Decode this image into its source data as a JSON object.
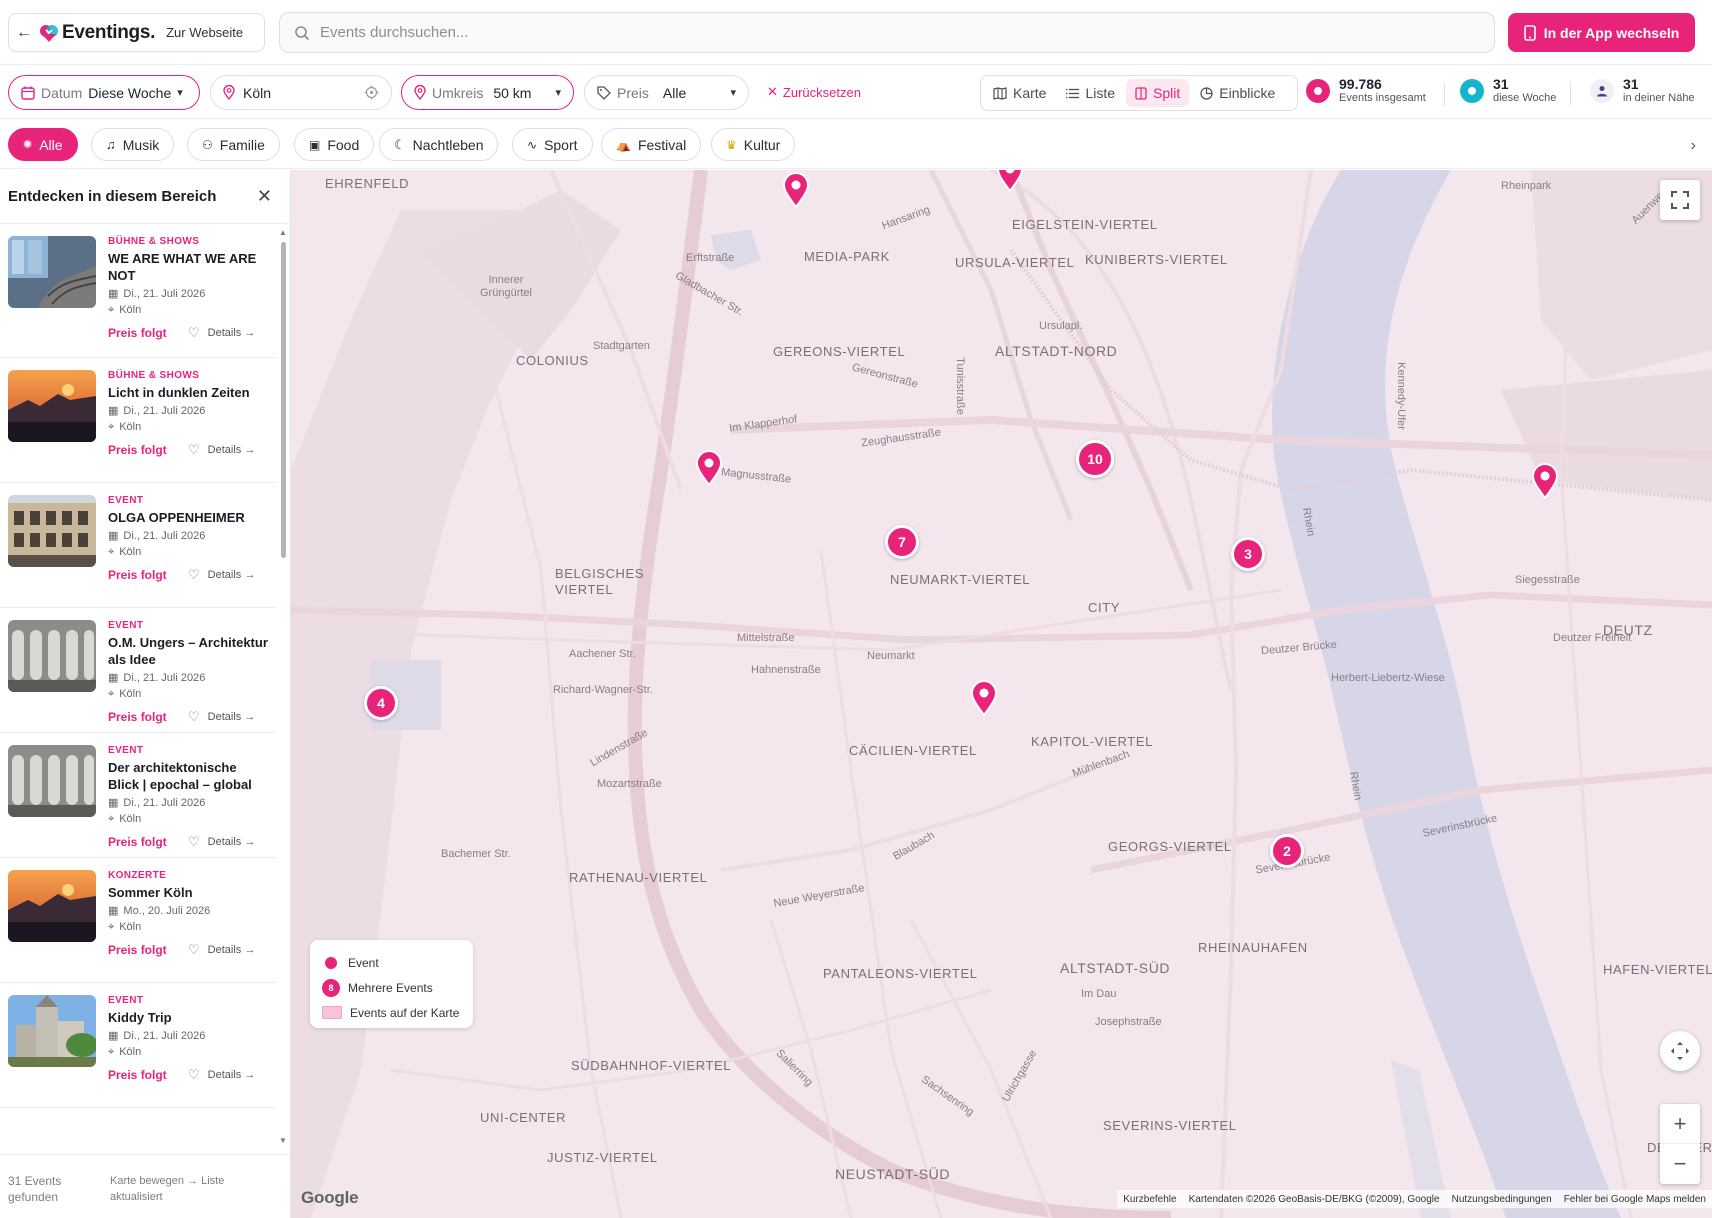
{
  "header": {
    "back_label": "←",
    "logo_text": "Eventings.",
    "website_link": "Zur Webseite",
    "search_placeholder": "Events durchsuchen...",
    "app_button": "In der App wechseln"
  },
  "filters": {
    "date_label": "Datum",
    "date_value": "Diese Woche",
    "location_value": "Köln",
    "radius_label": "Umkreis",
    "radius_value": "50 km",
    "price_label": "Preis",
    "price_value": "Alle",
    "reset_label": "Zurücksetzen"
  },
  "views": [
    {
      "label": "Karte",
      "icon": "map-icon",
      "active": false
    },
    {
      "label": "Liste",
      "icon": "list-icon",
      "active": false
    },
    {
      "label": "Split",
      "icon": "split-icon",
      "active": true
    },
    {
      "label": "Einblicke",
      "icon": "chart-pie-icon",
      "active": false
    }
  ],
  "stats": [
    {
      "value": "99.786",
      "label": "Events insgesamt",
      "color": "#e8247a"
    },
    {
      "value": "31",
      "label": "diese Woche",
      "color": "#12b5cb"
    },
    {
      "value": "31",
      "label": "in deiner Nähe",
      "color": "#4a3f8a"
    }
  ],
  "categories": [
    "Alle",
    "Musik",
    "Familie",
    "Food",
    "Nachtleben",
    "Sport",
    "Festival",
    "Kultur"
  ],
  "sidebar": {
    "title": "Entdecken in diesem Bereich",
    "events": [
      {
        "category": "BÜHNE & SHOWS",
        "title": "WE ARE WHAT WE ARE NOT",
        "date": "Di., 21. Juli 2026",
        "city": "Köln",
        "price": "Preis folgt",
        "details": "Details →",
        "thumb": "glass"
      },
      {
        "category": "BÜHNE & SHOWS",
        "title": "Licht in dunklen Zeiten",
        "date": "Di., 21. Juli 2026",
        "city": "Köln",
        "price": "Preis folgt",
        "details": "Details →",
        "thumb": "sunset"
      },
      {
        "category": "EVENT",
        "title": "OLGA OPPENHEIMER",
        "date": "Di., 21. Juli 2026",
        "city": "Köln",
        "price": "Preis folgt",
        "details": "Details →",
        "thumb": "building"
      },
      {
        "category": "EVENT",
        "title": "O.M. Ungers – Architektur als Idee",
        "date": "Di., 21. Juli 2026",
        "city": "Köln",
        "price": "Preis folgt",
        "details": "Details →",
        "thumb": "arcade"
      },
      {
        "category": "EVENT",
        "title": "Der architektonische Blick | epochal – global",
        "date": "Di., 21. Juli 2026",
        "city": "Köln",
        "price": "Preis folgt",
        "details": "Details →",
        "thumb": "arcade"
      },
      {
        "category": "KONZERTE",
        "title": "Sommer Köln",
        "date": "Mo., 20. Juli 2026",
        "city": "Köln",
        "price": "Preis folgt",
        "details": "Details →",
        "thumb": "sunset"
      },
      {
        "category": "EVENT",
        "title": "Kiddy Trip",
        "date": "Di., 21. Juli 2026",
        "city": "Köln",
        "price": "Preis folgt",
        "details": "Details →",
        "thumb": "church"
      }
    ],
    "footer_count": "31 Events gefunden",
    "footer_hint": "Karte bewegen → Liste aktualisiert"
  },
  "map": {
    "district_labels": [
      "EHRENFELD",
      "MEDIA-PARK",
      "EIGELSTEIN-VIERTEL",
      "URSULA-VIERTEL",
      "KUNIBERTS-VIERTEL",
      "GEREONS-VIERTEL",
      "ALTSTADT-NORD",
      "COLONIUS",
      "BELGISCHES VIERTEL",
      "NEUMARKT-VIERTEL",
      "CITY",
      "DEUTZ",
      "CÄCILIEN-VIERTEL",
      "KAPITOL-VIERTEL",
      "GEORGS-VIERTEL",
      "RATHENAU-VIERTEL",
      "RHEINAUHAFEN",
      "PANTALEONS-VIERTEL",
      "ALTSTADT-SÜD",
      "HAFEN-VIERTEL",
      "SÜDBAHNHOF-VIERTEL",
      "UNI-CENTER",
      "SEVERINS-VIERTEL",
      "JUSTIZ-VIERTEL",
      "NEUSTADT-SÜD",
      "DEUTZER H"
    ],
    "street_labels": [
      "Hansaring",
      "Erftstraße",
      "Gladbacher Str.",
      "Innerer Grüngürtel",
      "Stadtgarten",
      "Zeughausstraße",
      "Magnusstraße",
      "Im Klapperhof",
      "Gereonstraße",
      "Tunisstraße",
      "Aachener Str.",
      "Hahnenstraße",
      "Mittelstraße",
      "Neumarkt",
      "Richard-Wagner-Str.",
      "Deutzer Brücke",
      "Herbert-Liebertz-Wiese",
      "Severinsbrücke",
      "Severinsbrücke",
      "Neue Weyerstraße",
      "Mühlenbach",
      "Blaubach",
      "Bachemer Str.",
      "Rheinpark",
      "Auenweg",
      "Ursulapl.",
      "Rhein",
      "Rhein",
      "Mozartstraße",
      "Lindenstraße",
      "Kennedy-Ufer",
      "Deutzer Freiheit",
      "Siegesstraße",
      "Sachsenring",
      "Salierring",
      "Ulrichgasse",
      "Im Dau",
      "Josephstraße"
    ],
    "clusters": [
      "10",
      "7",
      "3",
      "4",
      "2"
    ],
    "legend": {
      "event": "Event",
      "multi": "Mehrere Events",
      "multi_sample": "8",
      "area": "Events auf der Karte"
    },
    "attribution": [
      "Kurzbefehle",
      "Kartendaten ©2026 GeoBasis-DE/BKG (©2009), Google",
      "Nutzungsbedingungen",
      "Fehler bei Google Maps melden"
    ],
    "google_logo": "Google",
    "zoom_in": "+",
    "zoom_out": "−"
  },
  "colors": {
    "accent": "#e8247a",
    "map_bg": "#f3e6ec",
    "river": "#d6d6e8"
  }
}
